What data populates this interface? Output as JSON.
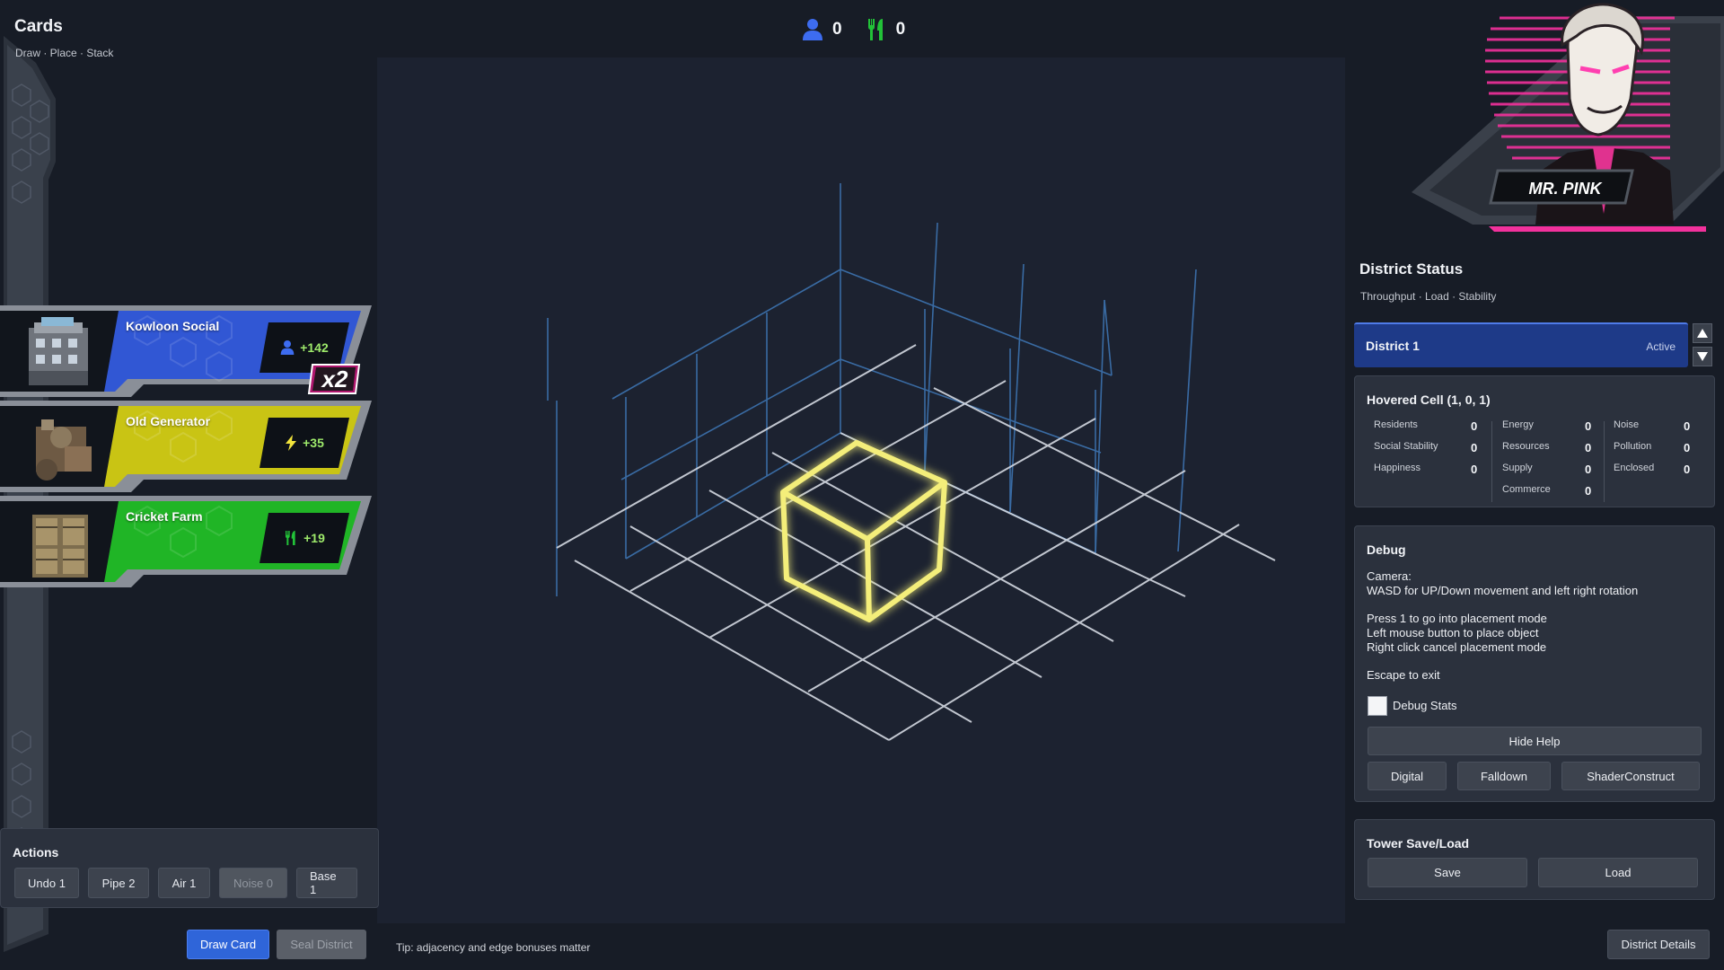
{
  "hand": {
    "title": "Cards",
    "subtitle": "Draw · Place · Stack",
    "cards": [
      {
        "name": "Kowloon Social",
        "value": "+142",
        "color": "#3157d4",
        "icon": "person-icon"
      },
      {
        "name": "Old Generator",
        "value": "+35",
        "color": "#c9c414",
        "icon": "bolt-icon"
      },
      {
        "name": "Cricket Farm",
        "value": "+19",
        "color": "#20b526",
        "icon": "fork-knife-icon"
      }
    ],
    "multiplier": "x2"
  },
  "top_stats": {
    "residents": {
      "icon": "person-icon",
      "value": "0",
      "color": "#3d6cf0"
    },
    "food": {
      "icon": "fork-knife-icon",
      "value": "0",
      "color": "#22c238"
    }
  },
  "actions": {
    "title": "Actions",
    "buttons": [
      {
        "label": "Undo 1",
        "disabled": false
      },
      {
        "label": "Pipe 2",
        "disabled": false
      },
      {
        "label": "Air 1",
        "disabled": false
      },
      {
        "label": "Noise 0",
        "disabled": true
      },
      {
        "label": "Base 1",
        "disabled": false
      }
    ]
  },
  "bottom": {
    "draw_card": "Draw Card",
    "seal_district": "Seal District",
    "tip": "Tip: adjacency and edge bonuses matter",
    "district_details": "District Details"
  },
  "advisor": {
    "name": "MR. PINK"
  },
  "status": {
    "title": "District Status",
    "subtitle": "Throughput · Load · Stability",
    "district": {
      "name": "District 1",
      "state": "Active"
    }
  },
  "hovered": {
    "title": "Hovered Cell (1, 0, 1)",
    "col1": [
      {
        "label": "Residents",
        "value": "0"
      },
      {
        "label": "Social Stability",
        "value": "0"
      },
      {
        "label": "Happiness",
        "value": "0"
      }
    ],
    "col2": [
      {
        "label": "Energy",
        "value": "0"
      },
      {
        "label": "Resources",
        "value": "0"
      },
      {
        "label": "Supply",
        "value": "0"
      },
      {
        "label": "Commerce",
        "value": "0"
      }
    ],
    "col3": [
      {
        "label": "Noise",
        "value": "0"
      },
      {
        "label": "Pollution",
        "value": "0"
      },
      {
        "label": "Enclosed",
        "value": "0"
      }
    ]
  },
  "debug": {
    "title": "Debug",
    "lines": [
      "Camera:",
      "WASD for UP/Down movement and left right rotation",
      "Press 1 to go into placement mode",
      "Left mouse button to place object",
      "Right click cancel placement mode",
      "Escape to exit"
    ],
    "checkbox_label": "Debug Stats",
    "hide_help": "Hide Help",
    "modes": [
      "Digital",
      "Falldown",
      "ShaderConstruct"
    ]
  },
  "save_load": {
    "title": "Tower Save/Load",
    "save": "Save",
    "load": "Load"
  }
}
